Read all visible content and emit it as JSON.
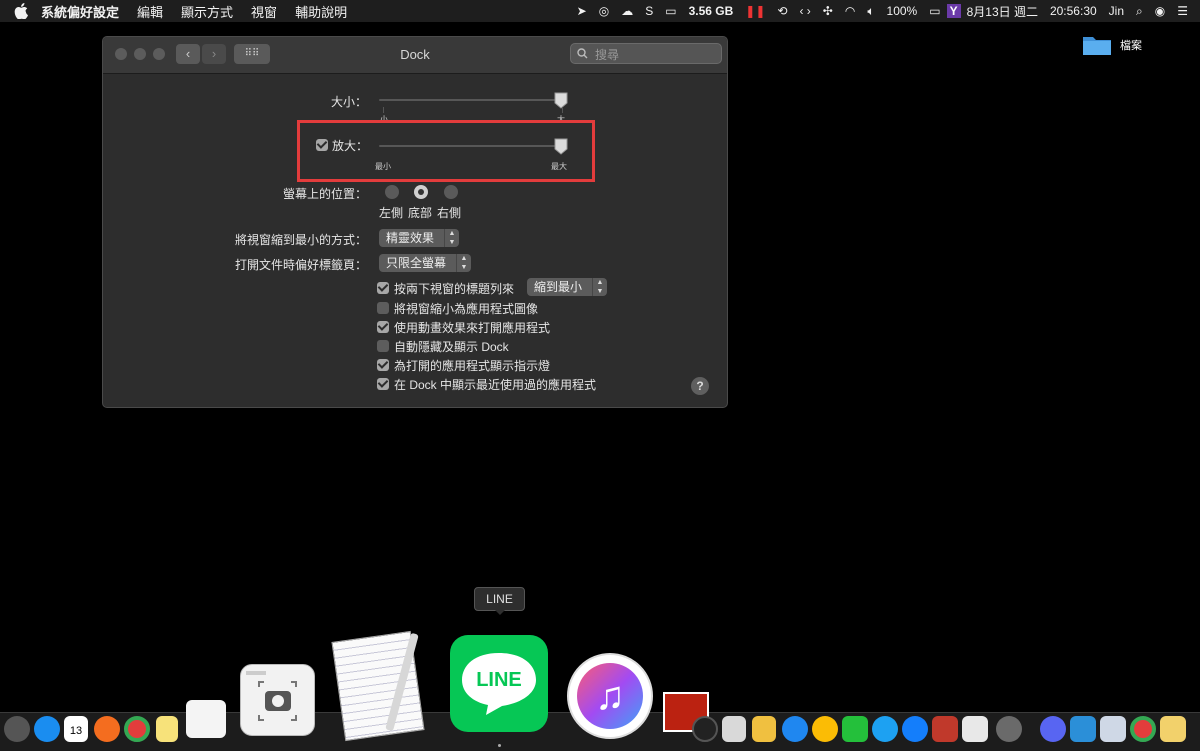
{
  "menubar": {
    "app_name": "系統偏好設定",
    "menus": [
      "編輯",
      "顯示方式",
      "視窗",
      "輔助說明"
    ],
    "status": {
      "memory": "3.56 GB",
      "battery": "100%",
      "date": "8月13日 週二",
      "time": "20:56:30",
      "user": "Jin"
    }
  },
  "desktop": {
    "folder_label": "檔案"
  },
  "window": {
    "title": "Dock",
    "search_placeholder": "搜尋",
    "size": {
      "label": "大小：",
      "min_label": "小",
      "max_label": "大",
      "value_fraction": 1.0
    },
    "magnification": {
      "label": "放大：",
      "checked": true,
      "min_label": "最小",
      "max_label": "最大",
      "value_fraction": 1.0
    },
    "position": {
      "label": "螢幕上的位置：",
      "options": [
        "左側",
        "底部",
        "右側"
      ],
      "selected": "底部"
    },
    "minimize_effect": {
      "label": "將視窗縮到最小的方式：",
      "value": "精靈效果"
    },
    "tabs_pref": {
      "label": "打開文件時偏好標籤頁：",
      "value": "只限全螢幕"
    },
    "options": [
      {
        "label": "按兩下視窗的標題列來",
        "checked": true,
        "popup": "縮到最小"
      },
      {
        "label": "將視窗縮小為應用程式圖像",
        "checked": false
      },
      {
        "label": "使用動畫效果來打開應用程式",
        "checked": true
      },
      {
        "label": "自動隱藏及顯示 Dock",
        "checked": false
      },
      {
        "label": "為打開的應用程式顯示指示燈",
        "checked": true
      },
      {
        "label": "在 Dock 中顯示最近使用過的應用程式",
        "checked": true
      }
    ],
    "help_label": "?"
  },
  "dock": {
    "tooltip": "LINE",
    "line_icon_text": "LINE",
    "calendar_day": "13",
    "colors": {
      "line_green": "#06c755",
      "highlight_red": "#e33c3c"
    }
  }
}
